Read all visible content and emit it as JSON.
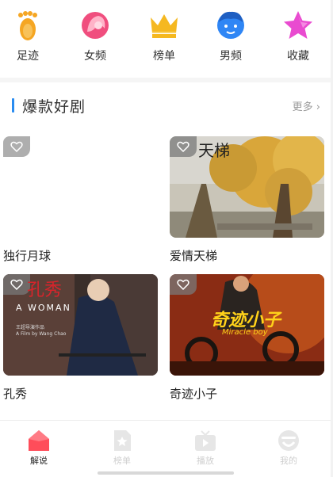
{
  "nav": {
    "items": [
      {
        "label": "足迹",
        "icon": "footprint-icon"
      },
      {
        "label": "女频",
        "icon": "female-avatar-icon"
      },
      {
        "label": "榜单",
        "icon": "crown-icon"
      },
      {
        "label": "男频",
        "icon": "male-avatar-icon"
      },
      {
        "label": "收藏",
        "icon": "star-icon"
      }
    ]
  },
  "section": {
    "title": "爆款好剧",
    "more_label": "更多"
  },
  "cards": [
    {
      "title": "独行月球",
      "poster_text": ""
    },
    {
      "title": "爱情天梯",
      "poster_text": "天梯"
    },
    {
      "title": "孔秀",
      "poster_text": "孔秀",
      "poster_subtitle": "A WOMAN",
      "poster_credit1": "王超导演作品",
      "poster_credit2": "A Film by Wang Chao"
    },
    {
      "title": "奇迹小子",
      "poster_text": "奇迹小子",
      "poster_subtitle": "Miracle boy"
    }
  ],
  "tabbar": {
    "items": [
      {
        "label": "解说",
        "icon": "home-icon",
        "active": true
      },
      {
        "label": "榜单",
        "icon": "ranking-icon",
        "active": false
      },
      {
        "label": "播放",
        "icon": "tv-play-icon",
        "active": false
      },
      {
        "label": "我的",
        "icon": "profile-icon",
        "active": false
      }
    ]
  },
  "colors": {
    "accent": "#2a8cf0",
    "active_tab": "#ff4d5a",
    "inactive_tab": "#e6e6e6"
  }
}
